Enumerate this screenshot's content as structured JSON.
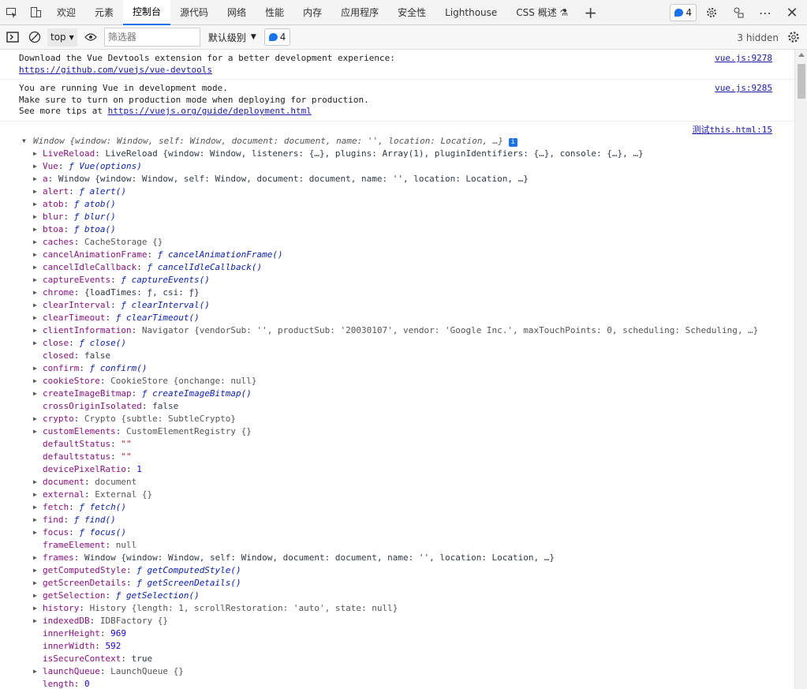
{
  "tabs": [
    "欢迎",
    "元素",
    "控制台",
    "源代码",
    "网络",
    "性能",
    "内存",
    "应用程序",
    "安全性",
    "Lighthouse",
    "CSS 概述 ⚗"
  ],
  "active_tab": 2,
  "issues_badge": "4",
  "toolbar": {
    "context": "top",
    "filter_placeholder": "筛选器",
    "level": "默认级别",
    "issues": "4",
    "hidden": "3 hidden"
  },
  "messages": [
    {
      "lines": [
        "Download the Vue Devtools extension for a better development experience:"
      ],
      "link": "https://github.com/vuejs/vue-devtools",
      "source": "vue.js:9278"
    },
    {
      "lines": [
        "You are running Vue in development mode.",
        "Make sure to turn on production mode when deploying for production."
      ],
      "prefix": "See more tips at ",
      "link": "https://vuejs.org/guide/deployment.html",
      "source": "vue.js:9285"
    }
  ],
  "log_source": "测试this.html:15",
  "object_header": "Window {window: Window, self: Window, document: document, name: '', location: Location, …}",
  "props": [
    {
      "e": true,
      "k": "LiveReload",
      "v": "LiveReload {window: Window, listeners: {…}, plugins: Array(1), pluginIdentifiers: {…}, console: {…}, …}",
      "t": "v"
    },
    {
      "e": true,
      "k": "Vue",
      "v": "ƒ Vue(options)",
      "t": "f"
    },
    {
      "e": true,
      "k": "a",
      "v": "Window {window: Window, self: Window, document: document, name: '', location: Location, …}",
      "t": "v"
    },
    {
      "e": true,
      "k": "alert",
      "v": "ƒ alert()",
      "t": "f"
    },
    {
      "e": true,
      "k": "atob",
      "v": "ƒ atob()",
      "t": "f"
    },
    {
      "e": true,
      "k": "blur",
      "v": "ƒ blur()",
      "t": "f"
    },
    {
      "e": true,
      "k": "btoa",
      "v": "ƒ btoa()",
      "t": "f"
    },
    {
      "e": true,
      "k": "caches",
      "v": "CacheStorage {}",
      "t": "g"
    },
    {
      "e": true,
      "k": "cancelAnimationFrame",
      "v": "ƒ cancelAnimationFrame()",
      "t": "f"
    },
    {
      "e": true,
      "k": "cancelIdleCallback",
      "v": "ƒ cancelIdleCallback()",
      "t": "f"
    },
    {
      "e": true,
      "k": "captureEvents",
      "v": "ƒ captureEvents()",
      "t": "f"
    },
    {
      "e": true,
      "k": "chrome",
      "v": "{loadTimes: ƒ, csi: ƒ}",
      "t": "v"
    },
    {
      "e": true,
      "k": "clearInterval",
      "v": "ƒ clearInterval()",
      "t": "f"
    },
    {
      "e": true,
      "k": "clearTimeout",
      "v": "ƒ clearTimeout()",
      "t": "f"
    },
    {
      "e": true,
      "k": "clientInformation",
      "v": "Navigator {vendorSub: '', productSub: '20030107', vendor: 'Google Inc.', maxTouchPoints: 0, scheduling: Scheduling, …}",
      "t": "g"
    },
    {
      "e": true,
      "k": "close",
      "v": "ƒ close()",
      "t": "f"
    },
    {
      "e": false,
      "k": "closed",
      "v": "false",
      "t": "v"
    },
    {
      "e": true,
      "k": "confirm",
      "v": "ƒ confirm()",
      "t": "f"
    },
    {
      "e": true,
      "k": "cookieStore",
      "v": "CookieStore {onchange: null}",
      "t": "g"
    },
    {
      "e": true,
      "k": "createImageBitmap",
      "v": "ƒ createImageBitmap()",
      "t": "f"
    },
    {
      "e": false,
      "k": "crossOriginIsolated",
      "v": "false",
      "t": "v"
    },
    {
      "e": true,
      "k": "crypto",
      "v": "Crypto {subtle: SubtleCrypto}",
      "t": "g"
    },
    {
      "e": true,
      "k": "customElements",
      "v": "CustomElementRegistry {}",
      "t": "g"
    },
    {
      "e": false,
      "k": "defaultStatus",
      "v": "\"\"",
      "t": "s"
    },
    {
      "e": false,
      "k": "defaultstatus",
      "v": "\"\"",
      "t": "s"
    },
    {
      "e": false,
      "k": "devicePixelRatio",
      "v": "1",
      "t": "n"
    },
    {
      "e": true,
      "k": "document",
      "v": "document",
      "t": "g"
    },
    {
      "e": true,
      "k": "external",
      "v": "External {}",
      "t": "g"
    },
    {
      "e": true,
      "k": "fetch",
      "v": "ƒ fetch()",
      "t": "f"
    },
    {
      "e": true,
      "k": "find",
      "v": "ƒ find()",
      "t": "f"
    },
    {
      "e": true,
      "k": "focus",
      "v": "ƒ focus()",
      "t": "f"
    },
    {
      "e": false,
      "k": "frameElement",
      "v": "null",
      "t": "g"
    },
    {
      "e": true,
      "k": "frames",
      "v": "Window {window: Window, self: Window, document: document, name: '', location: Location, …}",
      "t": "v"
    },
    {
      "e": true,
      "k": "getComputedStyle",
      "v": "ƒ getComputedStyle()",
      "t": "f"
    },
    {
      "e": true,
      "k": "getScreenDetails",
      "v": "ƒ getScreenDetails()",
      "t": "f"
    },
    {
      "e": true,
      "k": "getSelection",
      "v": "ƒ getSelection()",
      "t": "f"
    },
    {
      "e": true,
      "k": "history",
      "v": "History {length: 1, scrollRestoration: 'auto', state: null}",
      "t": "g"
    },
    {
      "e": true,
      "k": "indexedDB",
      "v": "IDBFactory {}",
      "t": "g"
    },
    {
      "e": false,
      "k": "innerHeight",
      "v": "969",
      "t": "n"
    },
    {
      "e": false,
      "k": "innerWidth",
      "v": "592",
      "t": "n"
    },
    {
      "e": false,
      "k": "isSecureContext",
      "v": "true",
      "t": "v"
    },
    {
      "e": true,
      "k": "launchQueue",
      "v": "LaunchQueue {}",
      "t": "g"
    },
    {
      "e": false,
      "k": "length",
      "v": "0",
      "t": "n"
    }
  ]
}
